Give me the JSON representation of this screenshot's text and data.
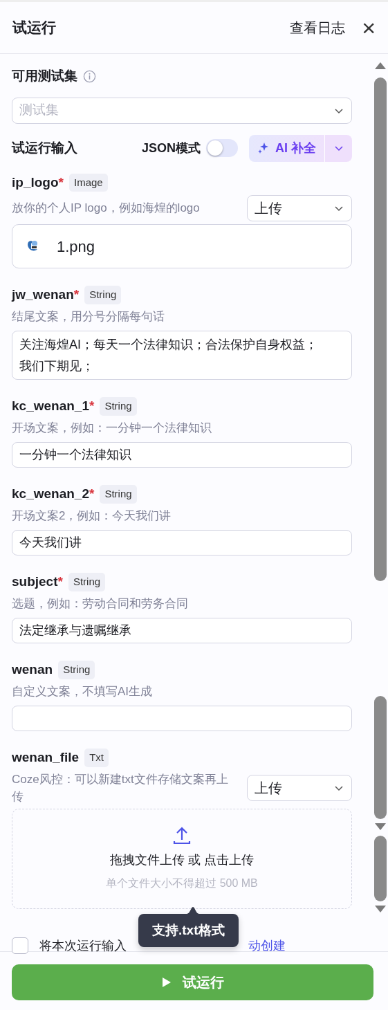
{
  "header": {
    "title": "试运行",
    "log_link": "查看日志",
    "close": "×"
  },
  "test_set": {
    "label": "可用测试集",
    "placeholder": "测试集"
  },
  "input_bar": {
    "label": "试运行输入",
    "json_mode_label": "JSON模式",
    "json_mode_on": false,
    "ai_button": "AI 补全"
  },
  "fields": [
    {
      "kind": "image-upload",
      "name": "ip_logo",
      "required_mark": "*",
      "type": "Image",
      "description": "放你的个人IP logo，例如海煌的logo",
      "mode": "上传",
      "file_name": "1.png"
    },
    {
      "kind": "textarea",
      "name": "jw_wenan",
      "required_mark": "*",
      "type": "String",
      "description": "结尾文案，用分号分隔每句话",
      "value": "关注海煌AI；每天一个法律知识；合法保护自身权益；我们下期见；"
    },
    {
      "kind": "text",
      "name": "kc_wenan_1",
      "required_mark": "*",
      "type": "String",
      "description": "开场文案，例如：一分钟一个法律知识",
      "value": "一分钟一个法律知识"
    },
    {
      "kind": "text",
      "name": "kc_wenan_2",
      "required_mark": "*",
      "type": "String",
      "description": "开场文案2，例如：今天我们讲",
      "value": "今天我们讲"
    },
    {
      "kind": "text",
      "name": "subject",
      "required_mark": "*",
      "type": "String",
      "description": "选题，例如：劳动合同和劳务合同",
      "value": "法定继承与遗嘱继承"
    },
    {
      "kind": "text",
      "name": "wenan",
      "type": "String",
      "description": "自定义文案，不填写AI生成"
    },
    {
      "kind": "file-upload",
      "name": "wenan_file",
      "type": "Txt",
      "description": "Coze风控：可以新建txt文件存储文案再上传",
      "mode": "上传",
      "drop_text": "拖拽文件上传 或 点击上传",
      "limit_text": "单个文件大小不得超过 500 MB",
      "tooltip": "支持.txt格式"
    }
  ],
  "save_option": {
    "checked": false,
    "label": "将本次运行输入",
    "link": "动创建"
  },
  "run_button": "试运行"
}
